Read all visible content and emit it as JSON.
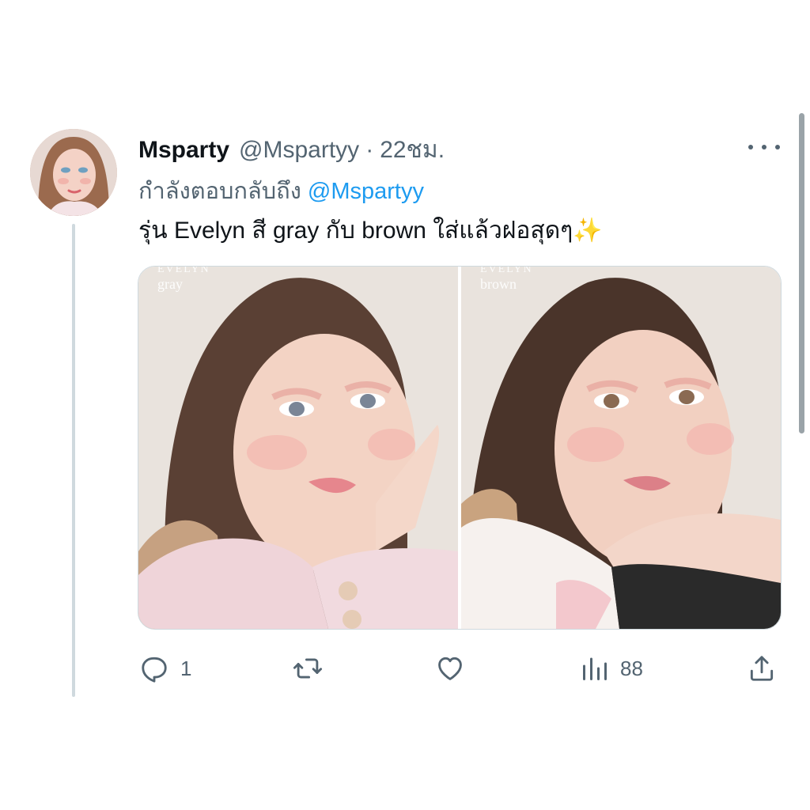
{
  "tweet": {
    "display_name": "Msparty",
    "handle": "@Mspartyy",
    "separator": "·",
    "time": "22ชม.",
    "reply_prefix": "กำลังตอบกลับถึง",
    "reply_to": "@Mspartyy",
    "text": "รุ่น Evelyn สี gray กับ brown ใส่แล้วฝอสุดๆ✨"
  },
  "media": {
    "left": {
      "brand": "EVELYN",
      "shade": "gray"
    },
    "right": {
      "brand": "EVELYN",
      "shade": "brown"
    }
  },
  "actions": {
    "reply_count": "1",
    "retweet_count": "",
    "like_count": "",
    "views_count": "88"
  },
  "icons": {
    "more": "more-horizontal-icon",
    "reply": "reply-icon",
    "retweet": "retweet-icon",
    "like": "heart-icon",
    "views": "analytics-icon",
    "share": "share-icon"
  },
  "colors": {
    "text_primary": "#0f1419",
    "text_secondary": "#536471",
    "link": "#1d9bf0",
    "border": "#cfd9de"
  }
}
